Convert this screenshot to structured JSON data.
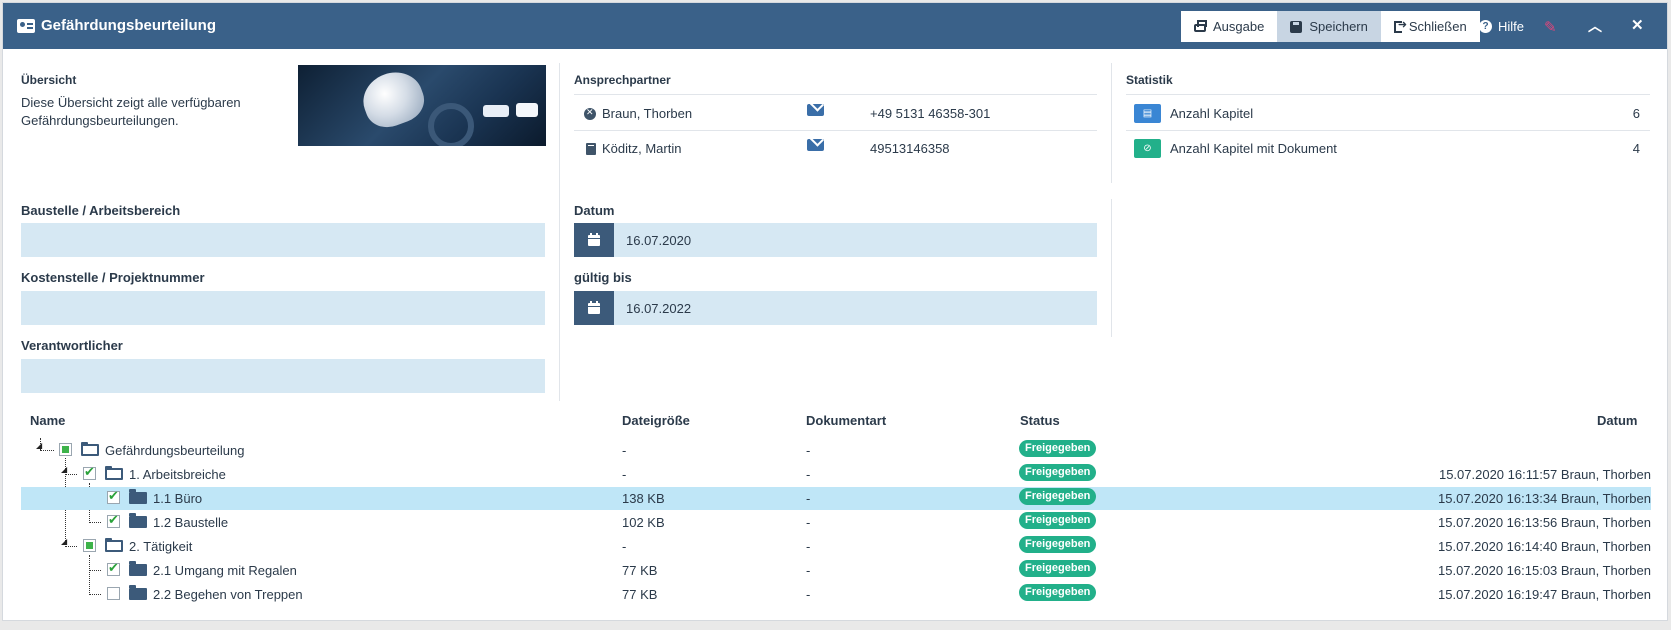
{
  "window": {
    "title": "Gefährdungsbeurteilung",
    "toolbar": {
      "ausgabe": "Ausgabe",
      "speichern": "Speichern",
      "schliessen": "Schließen",
      "hilfe": "Hilfe"
    }
  },
  "overview": {
    "heading": "Übersicht",
    "text": "Diese Übersicht zeigt alle verfügbaren Gefährdungsbeurteilungen."
  },
  "contacts": {
    "heading": "Ansprechpartner",
    "items": [
      {
        "name": "Braun, Thorben",
        "phone": "+49 5131 46358-301",
        "icon": "user-x-icon"
      },
      {
        "name": "Köditz, Martin",
        "phone": "49513146358",
        "icon": "book-icon"
      }
    ]
  },
  "stats": {
    "heading": "Statistik",
    "items": [
      {
        "label": "Anzahl Kapitel",
        "count": "6",
        "color": "#3a86d4",
        "icon": "file-icon"
      },
      {
        "label": "Anzahl Kapitel mit Dokument",
        "count": "4",
        "color": "#22b08a",
        "icon": "paperclip-icon"
      }
    ]
  },
  "form": {
    "baustelle": {
      "label": "Baustelle / Arbeitsbereich",
      "value": ""
    },
    "kostenstelle": {
      "label": "Kostenstelle / Projektnummer",
      "value": ""
    },
    "verantwortlicher": {
      "label": "Verantwortlicher",
      "value": ""
    },
    "datum": {
      "label": "Datum",
      "value": "16.07.2020"
    },
    "gueltig": {
      "label": "gültig bis",
      "value": "16.07.2022"
    }
  },
  "table": {
    "headers": {
      "name": "Name",
      "size": "Dateigröße",
      "type": "Dokumentart",
      "status": "Status",
      "date": "Datum"
    },
    "rows": [
      {
        "name": "Gefährdungsbeurteilung",
        "size": "-",
        "type": "-",
        "status": "Freigegeben",
        "date": "",
        "check": "partial",
        "level": 0
      },
      {
        "name": "1. Arbeitsbreiche",
        "size": "-",
        "type": "-",
        "status": "Freigegeben",
        "date": "15.07.2020 16:11:57 Braun, Thorben",
        "check": "checked",
        "level": 1
      },
      {
        "name": "1.1 Büro",
        "size": "138 KB",
        "type": "-",
        "status": "Freigegeben",
        "date": "15.07.2020 16:13:34 Braun, Thorben",
        "check": "checked",
        "level": 2,
        "selected": true
      },
      {
        "name": "1.2 Baustelle",
        "size": "102 KB",
        "type": "-",
        "status": "Freigegeben",
        "date": "15.07.2020 16:13:56 Braun, Thorben",
        "check": "checked",
        "level": 2
      },
      {
        "name": "2. Tätigkeit",
        "size": "-",
        "type": "-",
        "status": "Freigegeben",
        "date": "15.07.2020 16:14:40 Braun, Thorben",
        "check": "partial",
        "level": 1
      },
      {
        "name": "2.1 Umgang mit Regalen",
        "size": "77 KB",
        "type": "-",
        "status": "Freigegeben",
        "date": "15.07.2020 16:15:03 Braun, Thorben",
        "check": "checked",
        "level": 2
      },
      {
        "name": "2.2 Begehen von Treppen",
        "size": "77 KB",
        "type": "-",
        "status": "Freigegeben",
        "date": "15.07.2020 16:19:47 Braun, Thorben",
        "check": "none",
        "level": 2
      }
    ]
  }
}
